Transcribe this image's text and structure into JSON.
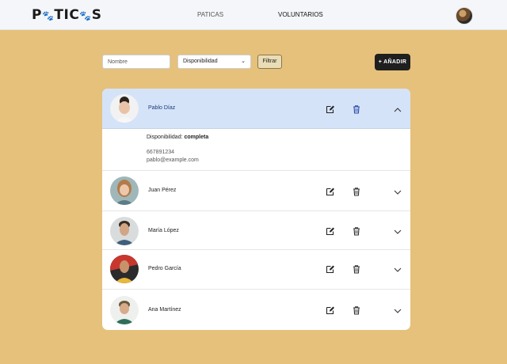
{
  "nav": {
    "logo_parts": [
      "P",
      "🐾",
      "TIC",
      "🐾",
      "S"
    ],
    "logo_text": "PATICAS",
    "links": [
      "PATICAS",
      "VOLUNTARIOS"
    ]
  },
  "filters": {
    "name_placeholder": "Nombre",
    "availability_value": "Disponibilidad",
    "filter_label": "Filtrar",
    "add_label": "+ AÑADIR"
  },
  "volunteers": [
    {
      "name": "Pablo Díaz",
      "expanded": true,
      "availability_label": "Disponibilidad:",
      "availability": "completa",
      "phone": "667891234",
      "email": "pablo@example.com"
    },
    {
      "name": "Juan Pérez",
      "expanded": false
    },
    {
      "name": "María López",
      "expanded": false
    },
    {
      "name": "Pedro García",
      "expanded": false
    },
    {
      "name": "Ana Martínez",
      "expanded": false
    }
  ],
  "colors": {
    "background": "#e6c17b",
    "selected_row": "#d5e3f9",
    "accent_blue": "#1e3a78",
    "add_button": "#1f1f1f"
  },
  "icons": [
    "edit-icon",
    "trash-icon",
    "chevron-up-icon",
    "chevron-down-icon"
  ]
}
